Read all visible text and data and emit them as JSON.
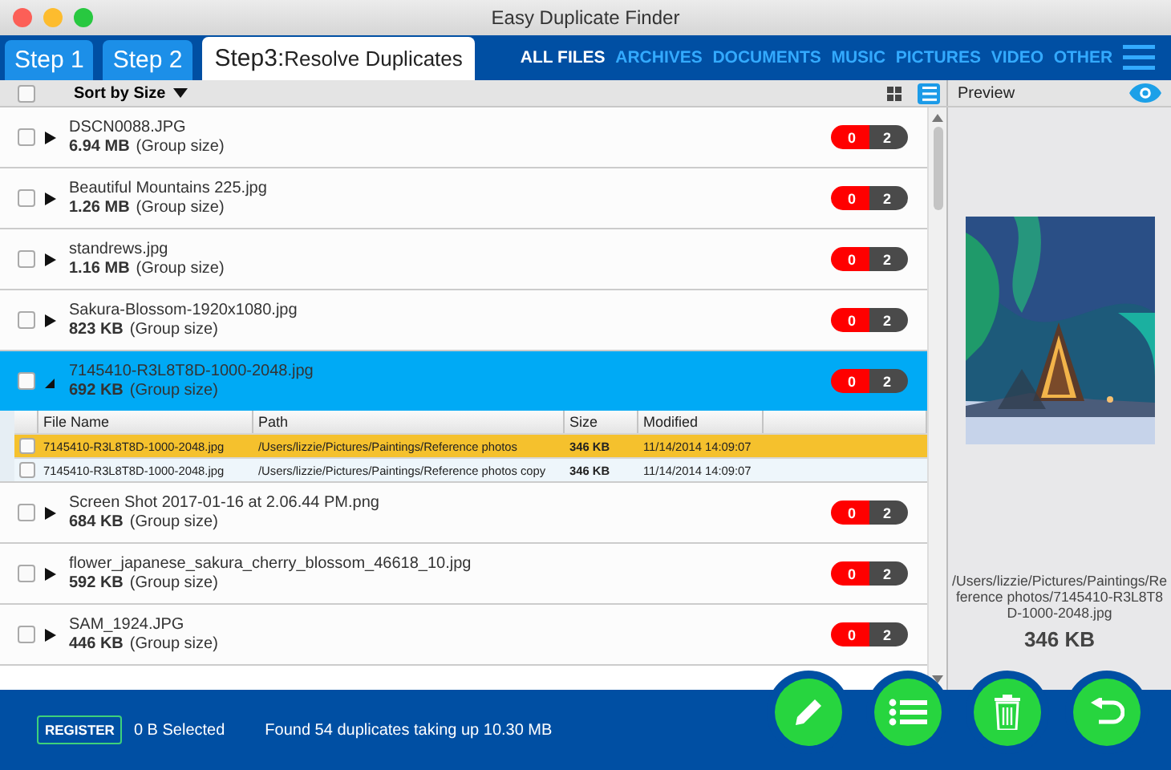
{
  "window": {
    "title": "Easy Duplicate Finder"
  },
  "steps": [
    {
      "label": "Step 1",
      "selected": false
    },
    {
      "label": "Step 2",
      "selected": false
    },
    {
      "label": "Step3:",
      "sublabel": "Resolve Duplicates",
      "selected": true
    }
  ],
  "categories": [
    {
      "label": "ALL FILES",
      "selected": true
    },
    {
      "label": "ARCHIVES",
      "selected": false
    },
    {
      "label": "DOCUMENTS",
      "selected": false
    },
    {
      "label": "MUSIC",
      "selected": false
    },
    {
      "label": "PICTURES",
      "selected": false
    },
    {
      "label": "VIDEO",
      "selected": false
    },
    {
      "label": "OTHER",
      "selected": false
    }
  ],
  "toolbar": {
    "select_all_checked": false,
    "sort_label": "Sort by Size",
    "view_modes": [
      {
        "kind": "grid",
        "selected": false
      },
      {
        "kind": "list",
        "selected": true
      }
    ]
  },
  "groups": [
    {
      "name": "DSCN0088.JPG",
      "size": "6.94 MB",
      "note": "(Group size)",
      "checked": false,
      "expanded": false,
      "selected": false,
      "marked": "0",
      "total": "2"
    },
    {
      "name": "Beautiful Mountains 225.jpg",
      "size": "1.26 MB",
      "note": "(Group size)",
      "checked": false,
      "expanded": false,
      "selected": false,
      "marked": "0",
      "total": "2"
    },
    {
      "name": "standrews.jpg",
      "size": "1.16 MB",
      "note": "(Group size)",
      "checked": false,
      "expanded": false,
      "selected": false,
      "marked": "0",
      "total": "2"
    },
    {
      "name": "Sakura-Blossom-1920x1080.jpg",
      "size": "823 KB",
      "note": "(Group size)",
      "checked": false,
      "expanded": false,
      "selected": false,
      "marked": "0",
      "total": "2"
    },
    {
      "name": "7145410-R3L8T8D-1000-2048.jpg",
      "size": "692 KB",
      "note": "(Group size)",
      "checked": false,
      "expanded": true,
      "selected": true,
      "marked": "0",
      "total": "2",
      "columns": [
        "File Name",
        "Path",
        "Size",
        "Modified"
      ],
      "files": [
        {
          "name": "7145410-R3L8T8D-1000-2048.jpg",
          "path": "/Users/lizzie/Pictures/Paintings/Reference photos",
          "size": "346 KB",
          "modified": "11/14/2014 14:09:07",
          "checked": false,
          "selected": true
        },
        {
          "name": "7145410-R3L8T8D-1000-2048.jpg",
          "path": "/Users/lizzie/Pictures/Paintings/Reference photos copy",
          "size": "346 KB",
          "modified": "11/14/2014 14:09:07",
          "checked": false,
          "selected": false
        }
      ]
    },
    {
      "name": "Screen Shot 2017-01-16 at 2.06.44 PM.png",
      "size": "684 KB",
      "note": "(Group size)",
      "checked": false,
      "expanded": false,
      "selected": false,
      "marked": "0",
      "total": "2"
    },
    {
      "name": "flower_japanese_sakura_cherry_blossom_46618_10.jpg",
      "size": "592 KB",
      "note": "(Group size)",
      "checked": false,
      "expanded": false,
      "selected": false,
      "marked": "0",
      "total": "2"
    },
    {
      "name": "SAM_1924.JPG",
      "size": "446 KB",
      "note": "(Group size)",
      "checked": false,
      "expanded": false,
      "selected": false,
      "marked": "0",
      "total": "2"
    }
  ],
  "preview": {
    "title": "Preview",
    "path": "/Users/lizzie/Pictures/Paintings/Reference photos/7145410-R3L8T8D-1000-2048.jpg",
    "size": "346 KB"
  },
  "status_bar": {
    "register": "REGISTER",
    "selected": "0 B Selected",
    "summary": "Found 54 duplicates taking up 10.30 MB"
  },
  "actions": [
    {
      "kind": "edit"
    },
    {
      "kind": "list"
    },
    {
      "kind": "trash"
    },
    {
      "kind": "undo"
    }
  ]
}
